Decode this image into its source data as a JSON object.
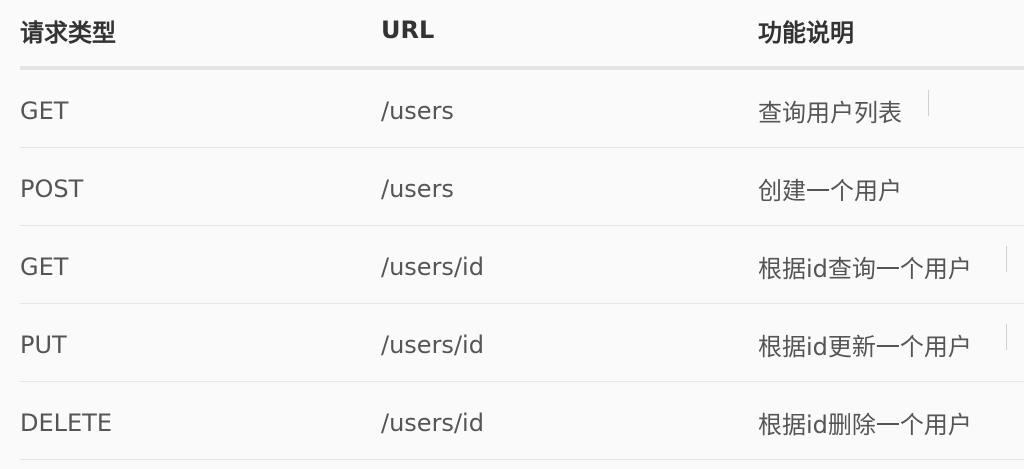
{
  "table": {
    "headers": {
      "method": "请求类型",
      "url": "URL",
      "description": "功能说明"
    },
    "rows": [
      {
        "method": "GET",
        "url": "/users",
        "description": "查询用户列表"
      },
      {
        "method": "POST",
        "url": "/users",
        "description": "创建一个用户"
      },
      {
        "method": "GET",
        "url": "/users/id",
        "description": "根据id查询一个用户"
      },
      {
        "method": "PUT",
        "url": "/users/id",
        "description": "根据id更新一个用户"
      },
      {
        "method": "DELETE",
        "url": "/users/id",
        "description": "根据id删除一个用户"
      }
    ]
  },
  "colors": {
    "background": "#fafafa",
    "text": "#555555",
    "header_text": "#333333",
    "divider": "#e6e6e6"
  }
}
